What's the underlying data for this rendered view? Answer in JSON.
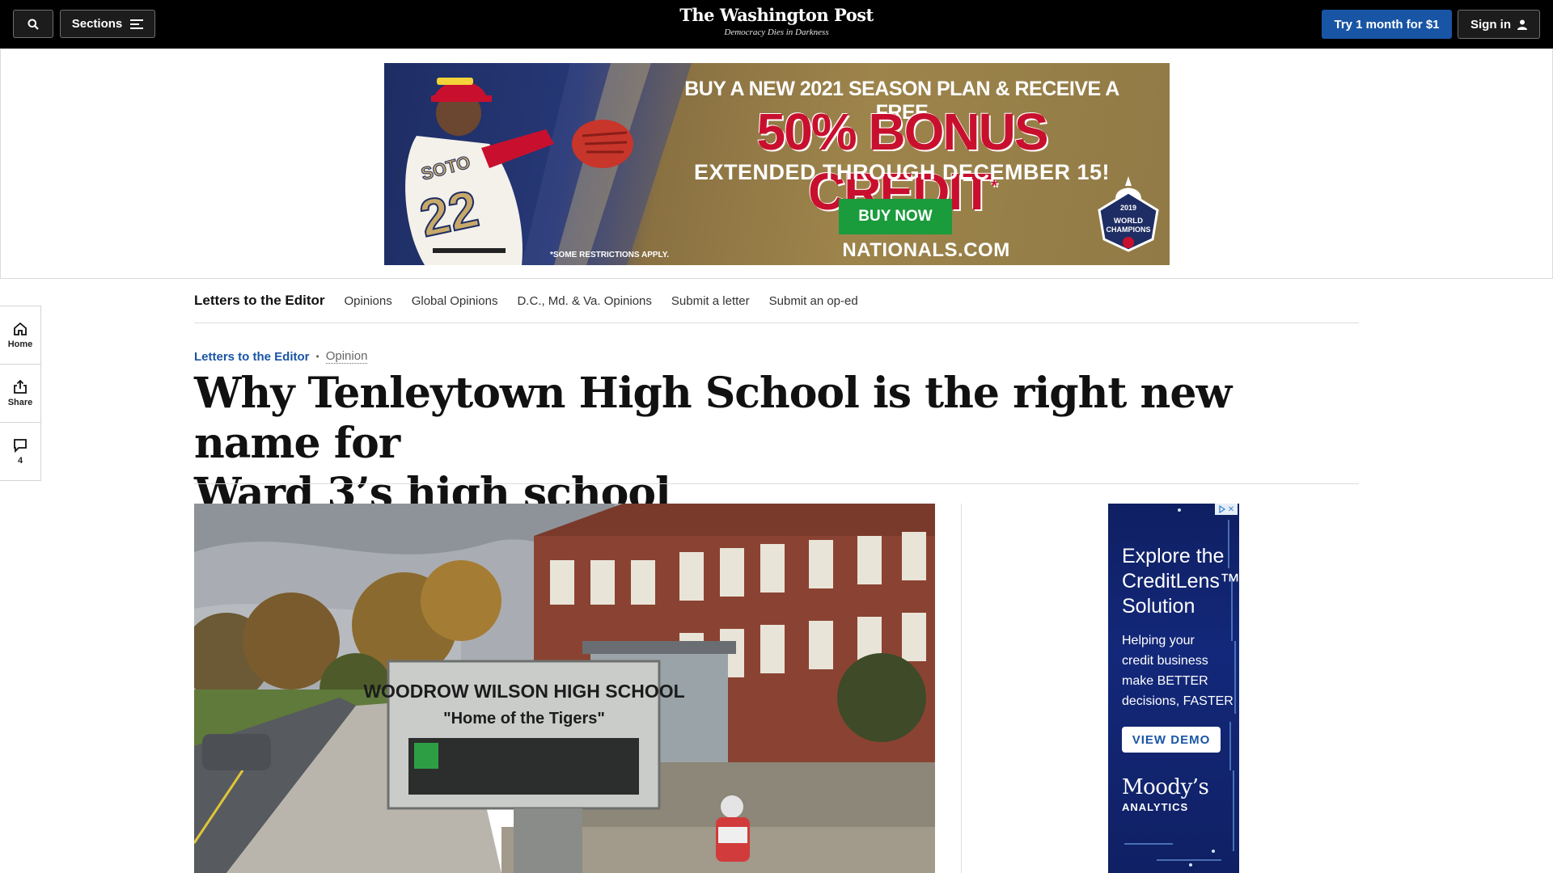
{
  "topbar": {
    "sections_label": "Sections",
    "logo": "The Washington Post",
    "tagline": "Democracy Dies in Darkness",
    "subscribe_label": "Try 1 month for $1",
    "signin_label": "Sign in"
  },
  "banner_ad": {
    "line1": "BUY A NEW 2021 SEASON PLAN & RECEIVE A FREE",
    "line2": "50% BONUS CREDIT",
    "line2_mark": "*",
    "line3": "EXTENDED THROUGH DECEMBER 15!",
    "cta": "BUY NOW",
    "domain": "NATIONALS.COM",
    "disclaimer": "*SOME RESTRICTIONS APPLY.",
    "jersey_name": "SOTO",
    "jersey_number": "22",
    "badge_year": "2019",
    "badge_text": "WORLD CHAMPIONS",
    "colors": {
      "navy": "#1e2d63",
      "gold": "#9d844b",
      "red": "#c8102e",
      "green": "#1a9b3c"
    }
  },
  "left_rail": {
    "home_label": "Home",
    "share_label": "Share",
    "comments_count": "4"
  },
  "section_nav": {
    "title": "Letters to the Editor",
    "links": [
      "Opinions",
      "Global Opinions",
      "D.C., Md. & Va. Opinions",
      "Submit a letter",
      "Submit an op-ed"
    ]
  },
  "article": {
    "kicker_section": "Letters to the Editor",
    "kicker_dot": "•",
    "kicker_label": "Opinion",
    "headline_line1": "Why Tenleytown High School is the right new name for",
    "headline_line2": "Ward 3’s high school"
  },
  "main_image": {
    "sign_line1": "WOODROW WILSON HIGH SCHOOL",
    "sign_line2": "\"Home of the Tigers\""
  },
  "side_ad": {
    "adchoice_icon": "adchoices-icon",
    "headline_lines": [
      "Explore the",
      "CreditLens™",
      "Solution"
    ],
    "body_lines": [
      "Helping your",
      "credit business",
      "make BETTER",
      "decisions, FASTER"
    ],
    "cta": "VIEW DEMO",
    "brand": "Moody’s",
    "brand_sub": "ANALYTICS",
    "colors": {
      "background": "#13287a",
      "cta_text": "#1955a5"
    }
  },
  "colors": {
    "accent": "#1955a5",
    "masthead_bg": "#000000"
  }
}
